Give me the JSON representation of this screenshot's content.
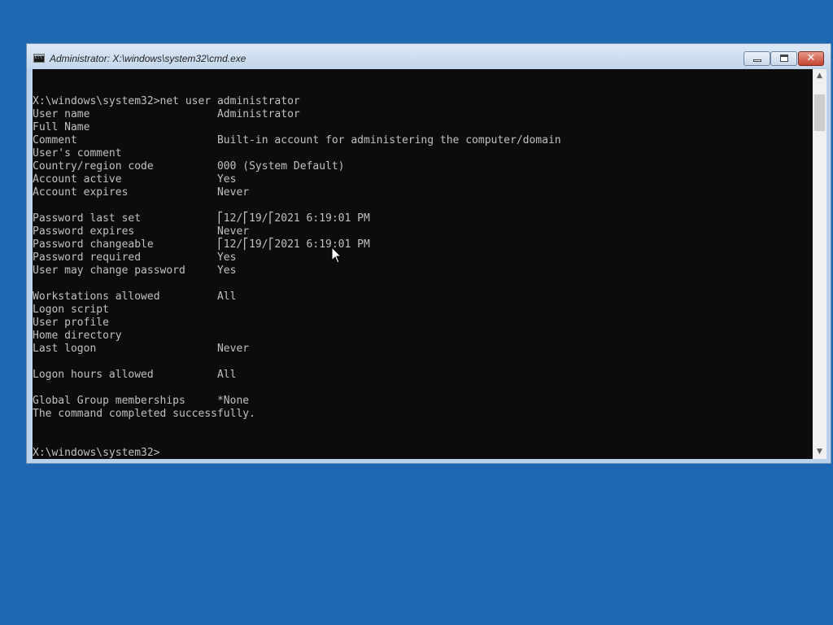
{
  "window": {
    "title": "Administrator: X:\\windows\\system32\\cmd.exe",
    "icon": "cmd-console-icon",
    "buttons": {
      "minimize_icon": "minimize-icon",
      "maximize_icon": "maximize-icon",
      "close_glyph": "✕"
    }
  },
  "console": {
    "lines": [
      "X:\\windows\\system32>net user administrator",
      "User name                    Administrator",
      "Full Name",
      "Comment                      Built-in account for administering the computer/domain",
      "User's comment",
      "Country/region code          000 (System Default)",
      "Account active               Yes",
      "Account expires              Never",
      "",
      "Password last set            ⎡12/⎡19/⎡2021 6:19:01 PM",
      "Password expires             Never",
      "Password changeable          ⎡12/⎡19/⎡2021 6:19:01 PM",
      "Password required            Yes",
      "User may change password     Yes",
      "",
      "Workstations allowed         All",
      "Logon script",
      "User profile",
      "Home directory",
      "Last logon                   Never",
      "",
      "Logon hours allowed          All",
      "",
      "Global Group memberships     *None",
      "The command completed successfully.",
      "",
      "",
      "X:\\windows\\system32>"
    ]
  },
  "scrollbar": {
    "up_arrow": "▲",
    "down_arrow": "▼"
  },
  "colors": {
    "desktop": "#1e67b3",
    "console_bg": "#0c0c0c",
    "console_text": "#c0c0c0"
  }
}
